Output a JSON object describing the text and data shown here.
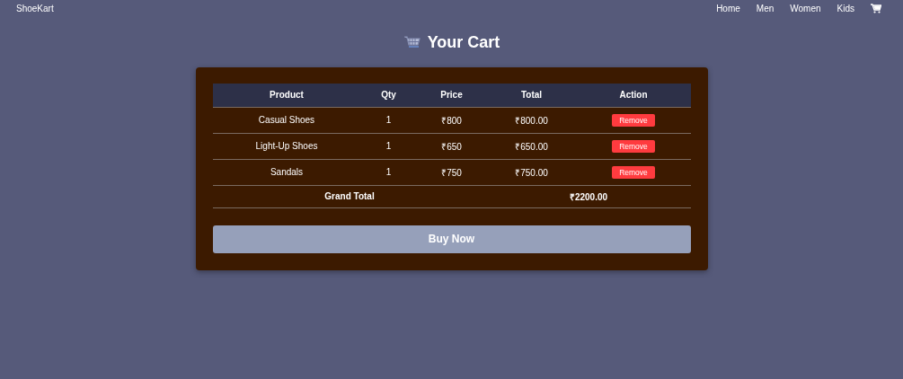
{
  "navbar": {
    "brand": "ShoeKart",
    "links": [
      "Home",
      "Men",
      "Women",
      "Kids"
    ]
  },
  "heading": "Your Cart",
  "table": {
    "columns": [
      "Product",
      "Qty",
      "Price",
      "Total",
      "Action"
    ],
    "rows": [
      {
        "product": "Casual Shoes",
        "qty": "1",
        "price": "₹800",
        "total": "₹800.00",
        "action": "Remove"
      },
      {
        "product": "Light-Up Shoes",
        "qty": "1",
        "price": "₹650",
        "total": "₹650.00",
        "action": "Remove"
      },
      {
        "product": "Sandals",
        "qty": "1",
        "price": "₹750",
        "total": "₹750.00",
        "action": "Remove"
      }
    ],
    "grand_total": {
      "label": "Grand Total",
      "value": "₹2200.00"
    }
  },
  "buy_button": "Buy Now"
}
